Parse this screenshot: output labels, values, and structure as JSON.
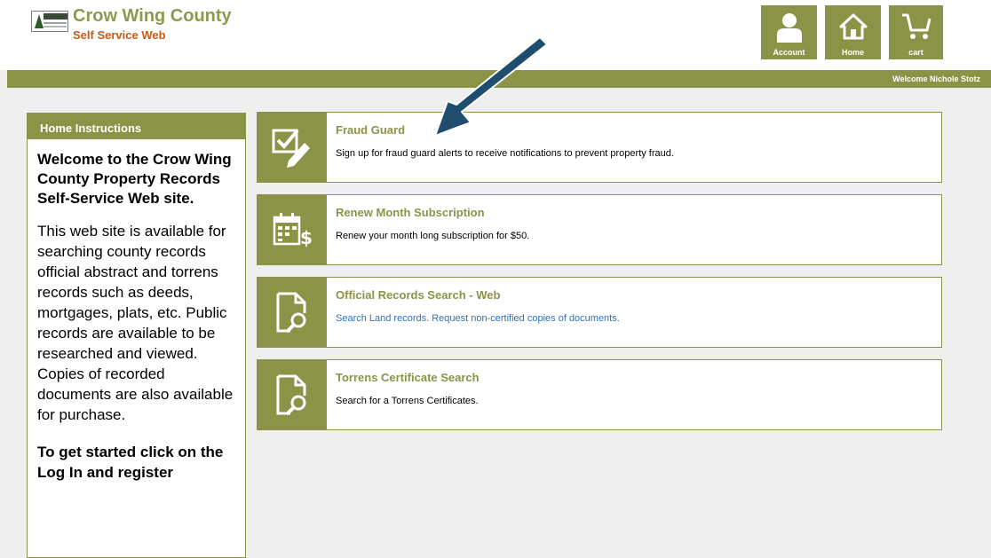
{
  "header": {
    "brand_title": "Crow Wing County",
    "brand_subtitle": "Self Service Web",
    "logo_icon": "county-logo-icon",
    "buttons": {
      "account": {
        "label": "Account",
        "icon": "user-icon"
      },
      "home": {
        "label": "Home",
        "icon": "home-icon"
      },
      "cart": {
        "label": "cart",
        "icon": "cart-icon"
      }
    },
    "welcome_text": "Welcome Nichole Stotz"
  },
  "sidebar": {
    "title": "Home Instructions",
    "welcome_heading": "Welcome to the Crow Wing County Property Records Self-Service Web site.",
    "body": "This web site is available for searching county records official abstract and torrens records such as deeds, mortgages, plats, etc. Public records are available to be researched and viewed. Copies of recorded documents are also available for purchase.",
    "cta": "To get started click on the Log In and register"
  },
  "cards": [
    {
      "title": "Fraud Guard",
      "description": "Sign up for fraud guard alerts to receive notifications to prevent property fraud.",
      "icon": "checkbox-pencil-icon"
    },
    {
      "title": "Renew Month Subscription",
      "description": "Renew your month long subscription for $50.",
      "icon": "calendar-dollar-icon"
    },
    {
      "title": "Official Records Search - Web",
      "description": "Search Land records. Request non-certified copies of documents.",
      "icon": "document-search-icon"
    },
    {
      "title": "Torrens Certificate Search",
      "description": "Search for a Torrens Certificates.",
      "icon": "document-search-icon"
    }
  ],
  "annotation": {
    "icon": "arrow-icon",
    "color": "#1e4d6e"
  },
  "colors": {
    "accent": "#8b9347",
    "brand_orange": "#c85a14",
    "link": "#2f70b6",
    "background": "#efefef"
  }
}
